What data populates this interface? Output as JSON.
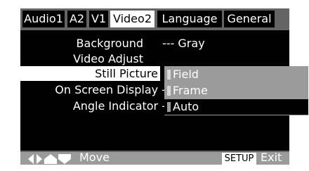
{
  "tabs": [
    {
      "label": "Audio1"
    },
    {
      "label": "A2"
    },
    {
      "label": "V1"
    },
    {
      "label": "Video2"
    },
    {
      "label": "Language"
    },
    {
      "label": "General"
    }
  ],
  "menu": {
    "background_label": "Background",
    "background_value": "--- Gray",
    "video_adjust_label": "Video Adjust",
    "still_picture_label": "Still Picture",
    "on_screen_display_label": "On Screen Displaу -",
    "angle_indicator_label": "Angle Indicator -"
  },
  "submenu": {
    "options": [
      "Field",
      "Frame",
      "Auto"
    ],
    "selected": "Auto"
  },
  "bottom": {
    "move_label": "Move",
    "setup_label": "SETUP",
    "exit_label": "Exit",
    "nav_icons": [
      "left-arrow-icon",
      "right-arrow-icon",
      "up-arrow-icon",
      "down-arrow-icon"
    ]
  },
  "colors": {
    "background": "#000000",
    "tab_bar": "#646464",
    "highlight": "#ffffff",
    "submenu": "#9b9b9b",
    "bottom_bar": "#9b9b9b"
  }
}
